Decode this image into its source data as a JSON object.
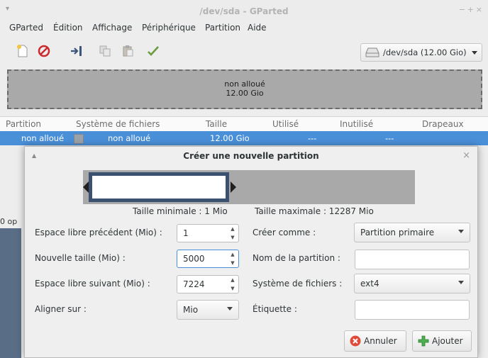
{
  "window": {
    "title": "/dev/sda - GParted"
  },
  "menubar": [
    "GParted",
    "Édition",
    "Affichage",
    "Périphérique",
    "Partition",
    "Aide"
  ],
  "toolbar": {
    "icons": [
      "new-icon",
      "delete-icon",
      "resize-icon",
      "copy-icon",
      "paste-icon",
      "apply-icon"
    ],
    "device": "/dev/sda  (12.00 Gio)"
  },
  "diskmap": {
    "label": "non alloué",
    "size": "12.00 Gio"
  },
  "table": {
    "headers": [
      "Partition",
      "Système de fichiers",
      "Taille",
      "Utilisé",
      "Inutilisé",
      "Drapeaux"
    ],
    "row": {
      "partition": "non alloué",
      "filesystem": "non alloué",
      "size": "12.00 Gio",
      "used": "---",
      "unused": "---"
    }
  },
  "status": "0 op",
  "dialog": {
    "title": "Créer une nouvelle partition",
    "min_size": "Taille minimale : 1 Mio",
    "max_size": "Taille maximale : 12287 Mio",
    "fields": {
      "free_before_label": "Espace libre précédent (Mio) :",
      "free_before_value": "1",
      "new_size_label": "Nouvelle taille (Mio) :",
      "new_size_value": "5000",
      "free_after_label": "Espace libre suivant (Mio) :",
      "free_after_value": "7224",
      "align_label": "Aligner sur :",
      "align_value": "Mio",
      "create_as_label": "Créer comme :",
      "create_as_value": "Partition primaire",
      "name_label": "Nom de la partition :",
      "fs_label": "Système de fichiers :",
      "fs_value": "ext4",
      "label_label": "Étiquette :"
    },
    "buttons": {
      "cancel": "Annuler",
      "add": "Ajouter"
    }
  },
  "colors": {
    "selection": "#4a90d9",
    "slider_border": "#3a5270",
    "cancel_red": "#e04a3a",
    "add_green": "#4caf50"
  }
}
